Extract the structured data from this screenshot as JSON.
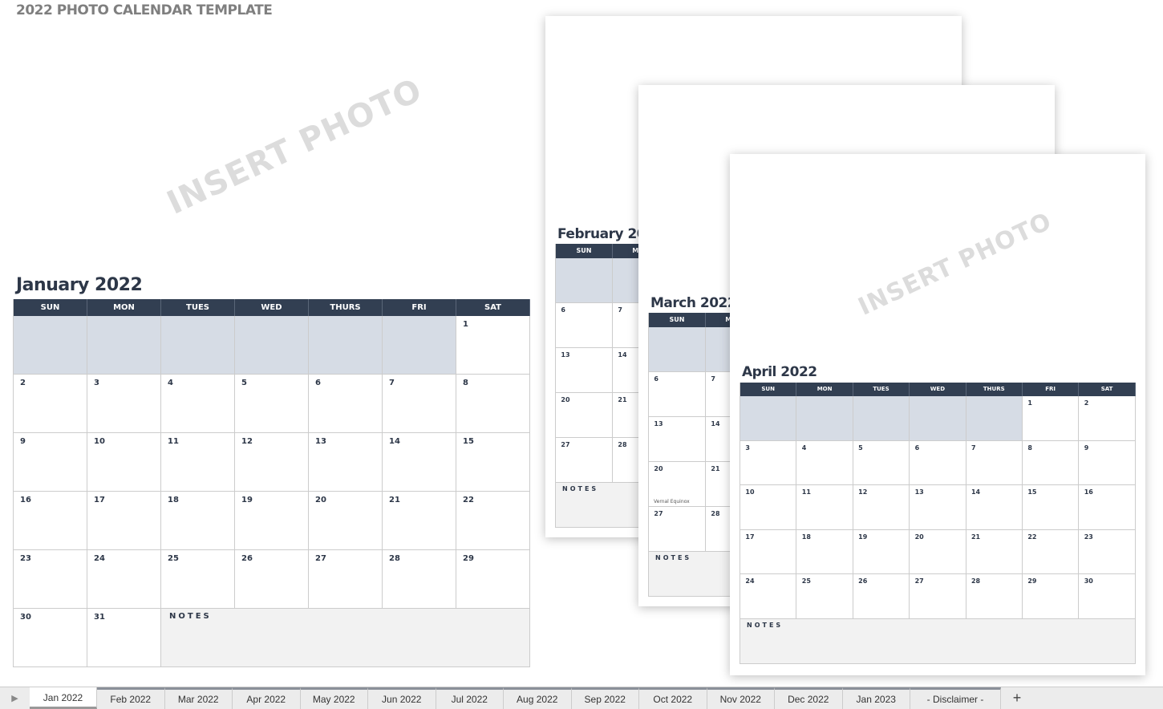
{
  "doc_title": "2022 PHOTO CALENDAR TEMPLATE",
  "watermark": "INSERT PHOTO",
  "colors": {
    "header": "#323f52",
    "shade": "#d6dce5",
    "notes": "#f2f2f2"
  },
  "notes_label": "NOTES",
  "calendars": [
    {
      "id": "jan",
      "title": "January 2022",
      "days": [
        "SUN",
        "MON",
        "TUES",
        "WED",
        "THURS",
        "FRI",
        "SAT"
      ],
      "weeks": [
        [
          "",
          "",
          "",
          "",
          "",
          "",
          "1"
        ],
        [
          "2",
          "3",
          "4",
          "5",
          "6",
          "7",
          "8"
        ],
        [
          "9",
          "10",
          "11",
          "12",
          "13",
          "14",
          "15"
        ],
        [
          "16",
          "17",
          "18",
          "19",
          "20",
          "21",
          "22"
        ],
        [
          "23",
          "24",
          "25",
          "26",
          "27",
          "28",
          "29"
        ],
        [
          "30",
          "31"
        ]
      ]
    },
    {
      "id": "feb",
      "title": "February 2022",
      "days": [
        "SUN",
        "MON"
      ],
      "weeks": [
        [
          "",
          ""
        ],
        [
          "6",
          "7"
        ],
        [
          "13",
          "14"
        ],
        [
          "20",
          "21"
        ],
        [
          "27",
          "28"
        ]
      ]
    },
    {
      "id": "mar",
      "title": "March 2022",
      "days": [
        "SUN",
        "MON"
      ],
      "weeks": [
        [
          "",
          ""
        ],
        [
          "6",
          "7"
        ],
        [
          "13",
          "14"
        ],
        [
          "20",
          "21"
        ],
        [
          "27",
          "28"
        ]
      ],
      "cell_notes": {
        "20": "Vernal Equinox"
      }
    },
    {
      "id": "apr",
      "title": "April 2022",
      "days": [
        "SUN",
        "MON",
        "TUES",
        "WED",
        "THURS",
        "FRI",
        "SAT"
      ],
      "weeks": [
        [
          "",
          "",
          "",
          "",
          "",
          "1",
          "2"
        ],
        [
          "3",
          "4",
          "5",
          "6",
          "7",
          "8",
          "9"
        ],
        [
          "10",
          "11",
          "12",
          "13",
          "14",
          "15",
          "16"
        ],
        [
          "17",
          "18",
          "19",
          "20",
          "21",
          "22",
          "23"
        ],
        [
          "24",
          "25",
          "26",
          "27",
          "28",
          "29",
          "30"
        ]
      ]
    }
  ],
  "sheet_tabs": [
    "Jan 2022",
    "Feb 2022",
    "Mar 2022",
    "Apr 2022",
    "May 2022",
    "Jun 2022",
    "Jul 2022",
    "Aug 2022",
    "Sep 2022",
    "Oct 2022",
    "Nov 2022",
    "Dec 2022",
    "Jan 2023",
    "- Disclaimer -"
  ],
  "active_tab": 0,
  "add_sheet": "+",
  "icons": {
    "nav": "play-right-icon"
  }
}
